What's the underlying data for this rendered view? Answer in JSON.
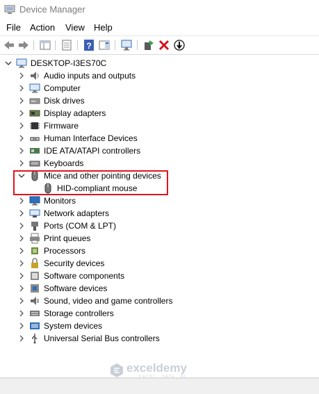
{
  "window": {
    "title": "Device Manager"
  },
  "menu": {
    "file": "File",
    "action": "Action",
    "view": "View",
    "help": "Help"
  },
  "tree": {
    "root": "DESKTOP-I3ES70C",
    "categories": [
      "Audio inputs and outputs",
      "Computer",
      "Disk drives",
      "Display adapters",
      "Firmware",
      "Human Interface Devices",
      "IDE ATA/ATAPI controllers",
      "Keyboards",
      "Mice and other pointing devices",
      "Monitors",
      "Network adapters",
      "Ports (COM & LPT)",
      "Print queues",
      "Processors",
      "Security devices",
      "Software components",
      "Software devices",
      "Sound, video and game controllers",
      "Storage controllers",
      "System devices",
      "Universal Serial Bus controllers"
    ],
    "expanded_category": "Mice and other pointing devices",
    "child_device": "HID-compliant mouse"
  },
  "watermark": {
    "name": "exceldemy",
    "tagline": "EXCEL · DATA · BI"
  },
  "colors": {
    "highlight_border": "#e0141c",
    "accent_blue": "#2d6fbd"
  }
}
